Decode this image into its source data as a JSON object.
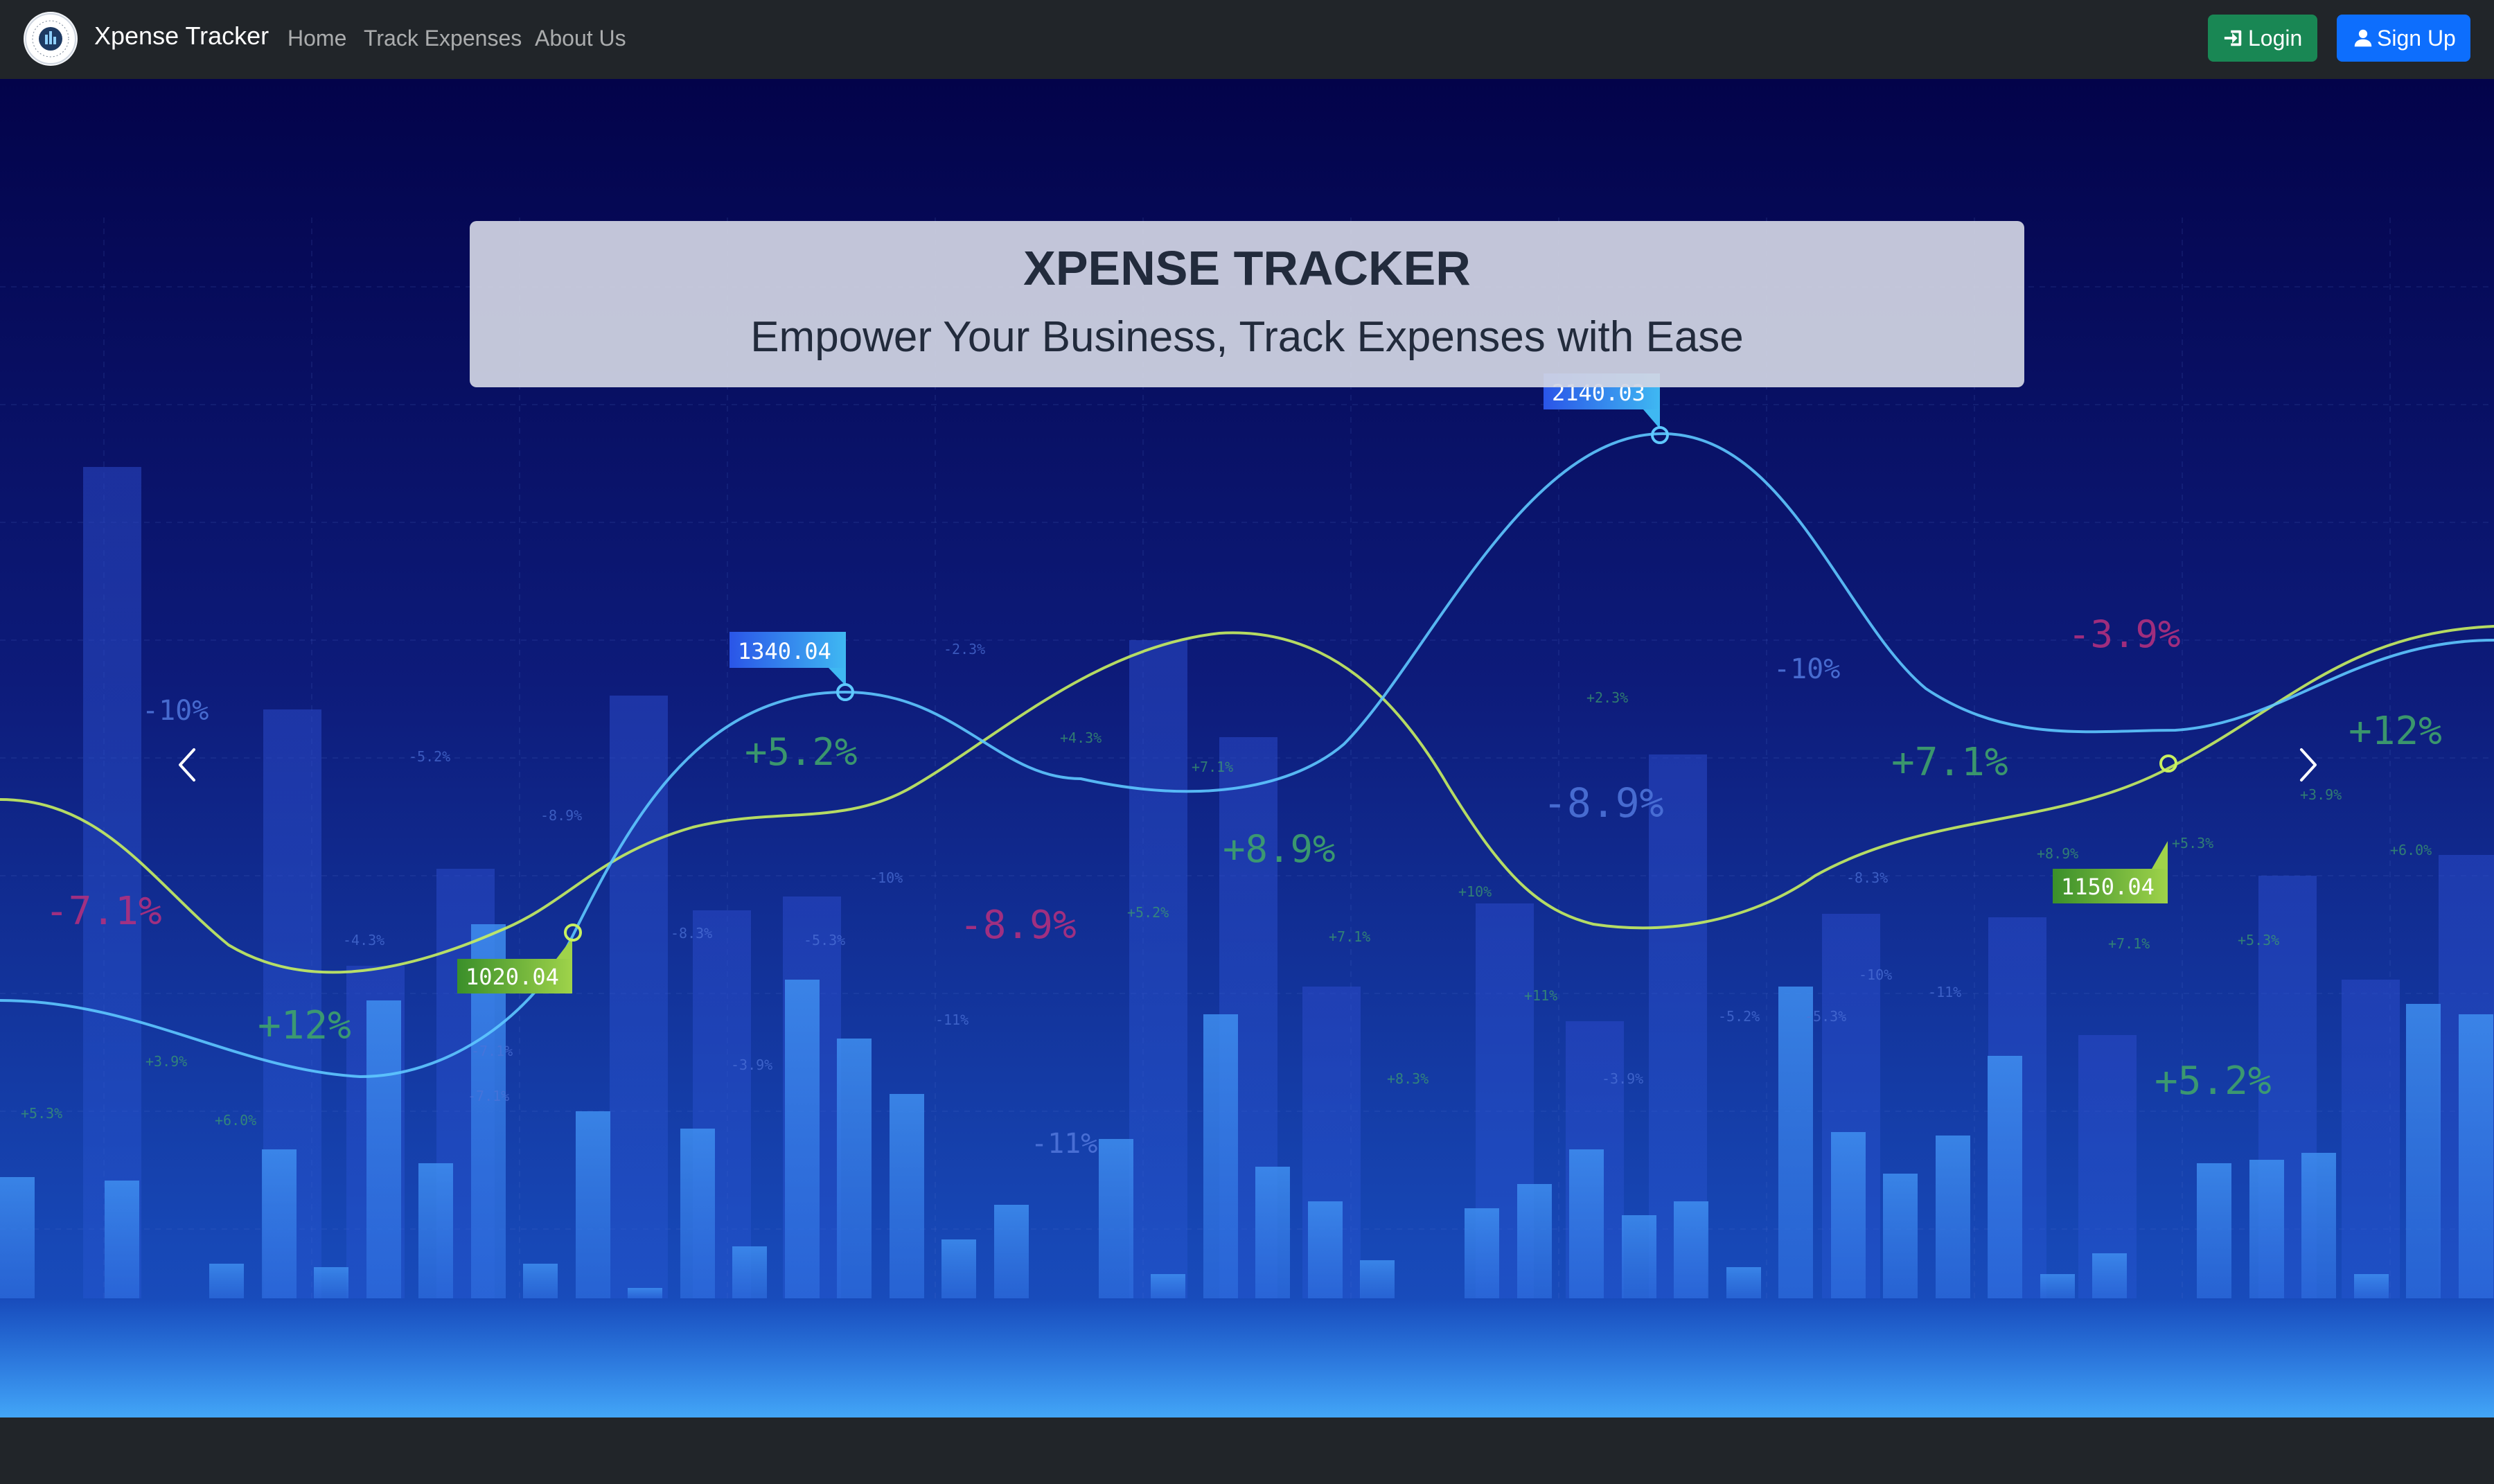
{
  "navbar": {
    "brand_name": "Xpense Tracker",
    "links": [
      "Home",
      "Track Expenses",
      "About Us"
    ],
    "login_label": "Login",
    "signup_label": "Sign Up"
  },
  "hero": {
    "title": "XPENSE TRACKER",
    "subtitle": "Empower Your Business, Track Expenses with Ease",
    "price_tags": [
      "1340.04",
      "2140.03",
      "1020.04",
      "1150.04"
    ],
    "big_percentages": [
      "-7.1%",
      "+12%",
      "+5.2%",
      "-8.9%",
      "+8.9%",
      "-8.9%",
      "+7.1%",
      "-3.9%",
      "+12%",
      "+5.2%",
      "-11%",
      "-10%",
      "-10%"
    ],
    "small_percentages": [
      "-2.3%",
      "+4.3%",
      "+7.1%",
      "-5.2%",
      "-8.9%",
      "-10%",
      "-8.3%",
      "-5.3%",
      "-4.3%",
      "-7.1%",
      "-3.9%",
      "-11%",
      "+5.2%",
      "+7.1%",
      "+10%",
      "+2.3%",
      "+11%",
      "+8.3%",
      "-3.9%",
      "-5.3%",
      "-5.2%",
      "-10%",
      "-8.3%",
      "+8.9%",
      "+5.3%",
      "+7.1%",
      "+5.3%",
      "+3.9%",
      "+6.0%",
      "-11%",
      "+5.3%",
      "+3.9%",
      "+6.0%",
      "-7.1%"
    ],
    "colors": {
      "accent_blue": "#5ec8ff",
      "accent_green": "#c8f060",
      "positive_text": "#3fa36a",
      "negative_text": "#b0307e",
      "neutral_text": "#4e73d8"
    }
  }
}
